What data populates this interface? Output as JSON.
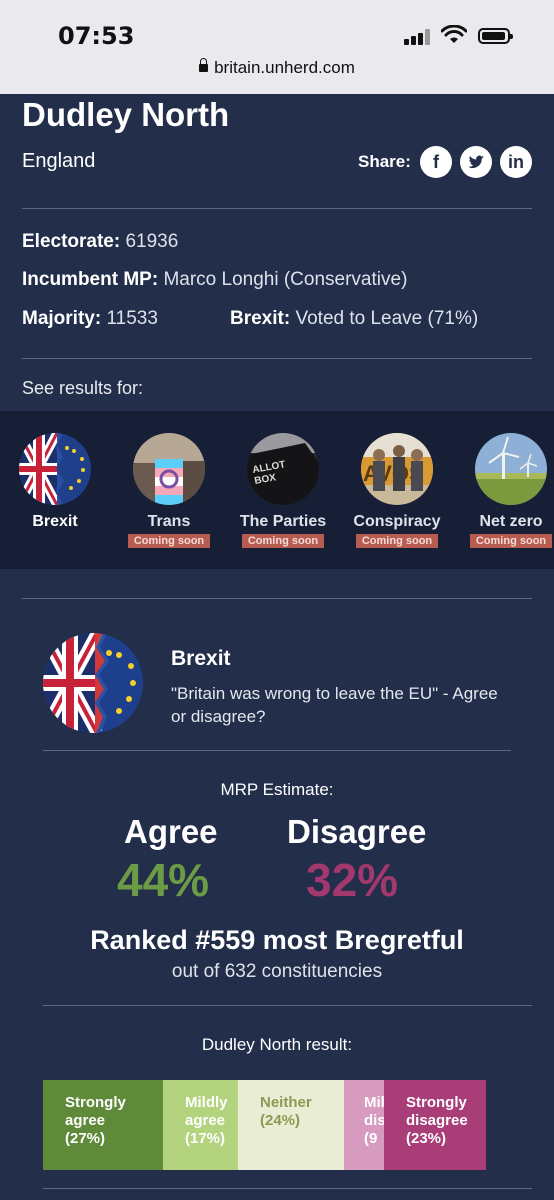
{
  "status_bar": {
    "time": "07:53"
  },
  "url": "britain.unherd.com",
  "constituency": {
    "name": "Dudley North",
    "region": "England",
    "share_label": "Share:",
    "share_icons": [
      "facebook-icon",
      "twitter-icon",
      "linkedin-icon"
    ],
    "electorate_label": "Electorate:",
    "electorate": "61936",
    "incumbent_label": "Incumbent MP:",
    "incumbent": "Marco Longhi (Conservative)",
    "majority_label": "Majority:",
    "majority": "11533",
    "brexit_label": "Brexit:",
    "brexit": "Voted to Leave (71%)"
  },
  "see_results_label": "See results for:",
  "topics": [
    {
      "label": "Brexit",
      "badge": ""
    },
    {
      "label": "Trans",
      "badge": "Coming soon"
    },
    {
      "label": "The Parties",
      "badge": "Coming soon"
    },
    {
      "label": "Conspiracy",
      "badge": "Coming soon"
    },
    {
      "label": "Net zero",
      "badge": "Coming soon"
    }
  ],
  "card": {
    "title": "Brexit",
    "question": "\"Britain was wrong to leave the EU\" - Agree or disagree?",
    "mrp_label": "MRP Estimate:",
    "agree_label": "Agree",
    "agree_value": "44%",
    "disagree_label": "Disagree",
    "disagree_value": "32%",
    "ranked": "Ranked #559 most Bregretful",
    "out_of": "out of 632 constituencies",
    "result_title": "Dudley North result:"
  },
  "result_bar": [
    {
      "text_lines": [
        "Strongly",
        "agree",
        "(27%)"
      ],
      "percent": 27,
      "bg": "#5e8a3a",
      "fg": "#ffffff"
    },
    {
      "text_lines": [
        "Mildly",
        "agree",
        "(17%)"
      ],
      "percent": 17,
      "bg": "#b3d37f",
      "fg": "#ffffff"
    },
    {
      "text_lines": [
        "Neither",
        "(24%)"
      ],
      "percent": 24,
      "bg": "#e9edd4",
      "fg": "#8d9a53"
    },
    {
      "text_lines": [
        "Mil",
        "dis",
        "(9"
      ],
      "percent": 9,
      "bg": "#d79bc0",
      "fg": "#ffffff"
    },
    {
      "text_lines": [
        "Strongly",
        "disagree",
        "(23%)"
      ],
      "percent": 23,
      "bg": "#a93d78",
      "fg": "#ffffff"
    }
  ],
  "colors": {
    "background": "#222e4a",
    "agree": "#6c9b45",
    "disagree": "#a2386e",
    "badge": "#b85c52"
  }
}
